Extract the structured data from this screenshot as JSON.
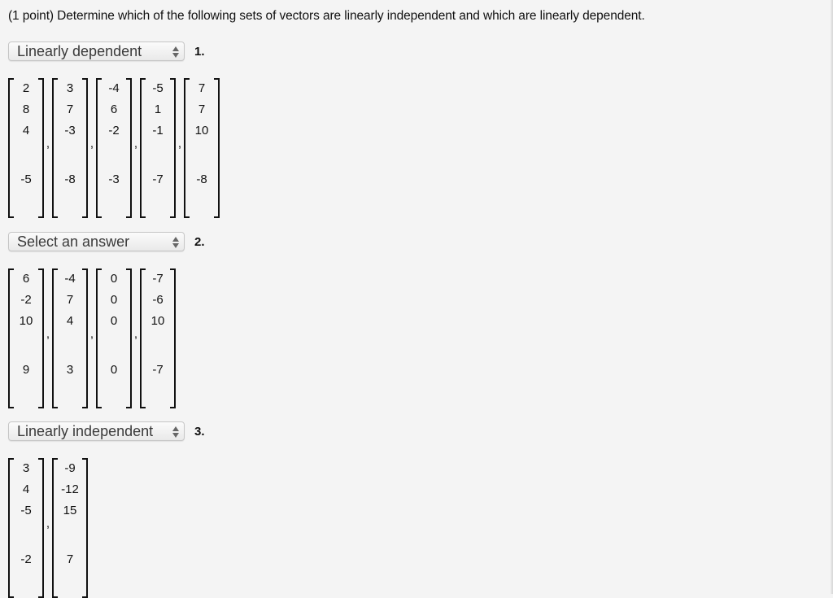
{
  "prompt": "(1 point) Determine which of the following sets of vectors are linearly independent and which are linearly dependent.",
  "problems": [
    {
      "number": "1.",
      "selected": "Linearly dependent",
      "vectors": [
        [
          "2",
          "8",
          "4",
          "-5"
        ],
        [
          "3",
          "7",
          "-3",
          "-8"
        ],
        [
          "-4",
          "6",
          "-2",
          "-3"
        ],
        [
          "-5",
          "1",
          "-1",
          "-7"
        ],
        [
          "7",
          "7",
          "10",
          "-8"
        ]
      ]
    },
    {
      "number": "2.",
      "selected": "Select an answer",
      "vectors": [
        [
          "6",
          "-2",
          "10",
          "9"
        ],
        [
          "-4",
          "7",
          "4",
          "3"
        ],
        [
          "0",
          "0",
          "0",
          "0"
        ],
        [
          "-7",
          "-6",
          "10",
          "-7"
        ]
      ]
    },
    {
      "number": "3.",
      "selected": "Linearly independent",
      "vectors": [
        [
          "3",
          "4",
          "-5",
          "-2"
        ],
        [
          "-9",
          "-12",
          "15",
          "7"
        ]
      ]
    }
  ],
  "separator": ","
}
